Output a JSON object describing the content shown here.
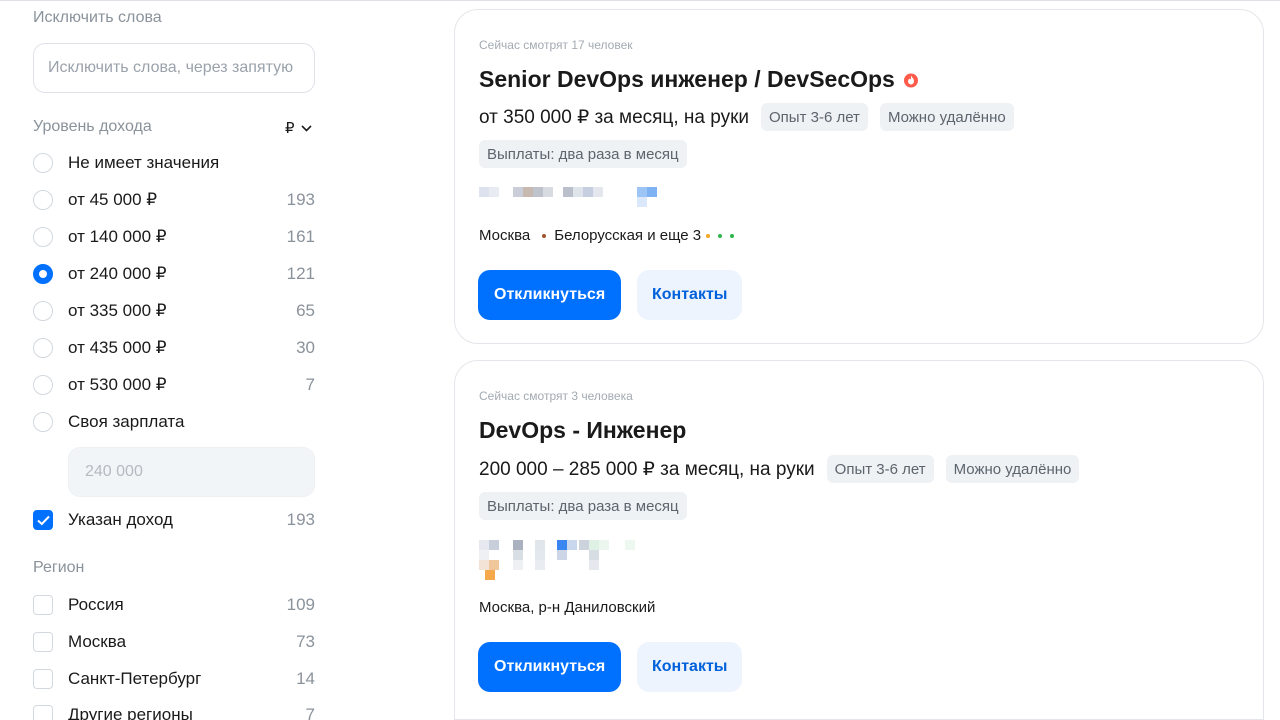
{
  "filters": {
    "exclude_words": {
      "title": "Исключить слова",
      "placeholder": "Исключить слова, через запятую"
    },
    "income": {
      "title": "Уровень дохода",
      "currency": "₽",
      "options": [
        {
          "label": "Не имеет значения",
          "count": "",
          "checked": false
        },
        {
          "label": "от 45 000 ₽",
          "count": "193",
          "checked": false
        },
        {
          "label": "от 140 000 ₽",
          "count": "161",
          "checked": false
        },
        {
          "label": "от 240 000 ₽",
          "count": "121",
          "checked": true
        },
        {
          "label": "от 335 000 ₽",
          "count": "65",
          "checked": false
        },
        {
          "label": "от 435 000 ₽",
          "count": "30",
          "checked": false
        },
        {
          "label": "от 530 000 ₽",
          "count": "7",
          "checked": false
        },
        {
          "label": "Своя зарплата",
          "count": "",
          "checked": false
        }
      ],
      "custom_salary_placeholder": "240 000",
      "salary_specified": {
        "label": "Указан доход",
        "count": "193",
        "checked": true
      }
    },
    "region": {
      "title": "Регион",
      "options": [
        {
          "label": "Россия",
          "count": "109",
          "checked": false
        },
        {
          "label": "Москва",
          "count": "73",
          "checked": false
        },
        {
          "label": "Санкт-Петербург",
          "count": "14",
          "checked": false
        },
        {
          "label": "Другие регионы",
          "count": "7",
          "checked": false
        }
      ]
    }
  },
  "vacancies": [
    {
      "viewers": "Сейчас смотрят 17 человек",
      "title": "Senior DevOps инженер / DevSecOps",
      "hot_icon": "fire-icon",
      "salary": "от 350 000 ₽ за месяц, на руки",
      "experience": "Опыт 3-6 лет",
      "remote": "Можно удалённо",
      "payout": "Выплаты: два раза в месяц",
      "location": "Москва",
      "metro": "Белорусская и еще 3",
      "metro_color": "#a0522d",
      "extra_metro_colors": [
        "#f5a623",
        "#2fb54a",
        "#2fb54a"
      ],
      "apply_label": "Откликнуться",
      "contacts_label": "Контакты"
    },
    {
      "viewers": "Сейчас смотрят 3 человека",
      "title": "DevOps - Инженер",
      "salary": "200 000 – 285 000 ₽ за месяц, на руки",
      "experience": "Опыт 3-6 лет",
      "remote": "Можно удалённо",
      "payout": "Выплаты: два раза в месяц",
      "location": "Москва, р-н Даниловский",
      "apply_label": "Откликнуться",
      "contacts_label": "Контакты"
    }
  ],
  "colors": {
    "accent": "#0070ff",
    "secondary_button_bg": "#eef4fd",
    "muted_text": "#8a929b"
  }
}
